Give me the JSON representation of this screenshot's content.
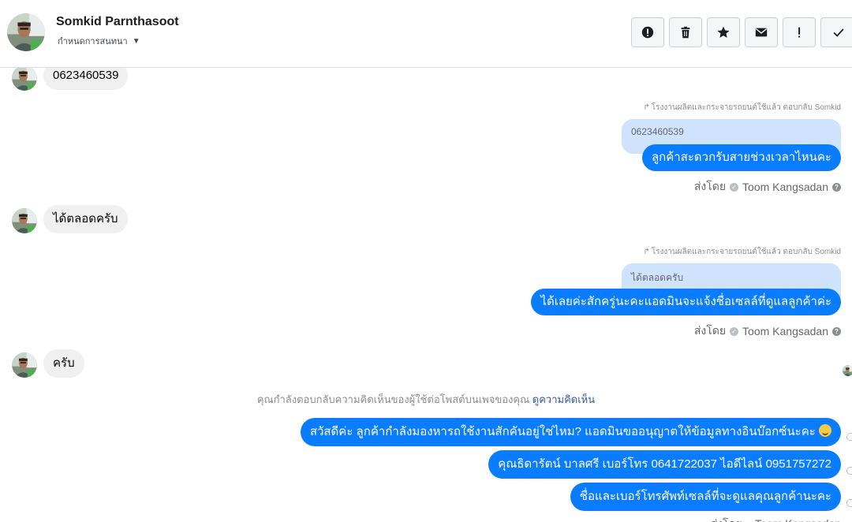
{
  "header": {
    "contact_name": "Somkid Parnthasoot",
    "conversation_label": "กำหนดการสนทนา",
    "actions": [
      {
        "name": "mark-spam",
        "icon": "alert-circle-icon"
      },
      {
        "name": "delete",
        "icon": "trash-icon"
      },
      {
        "name": "star",
        "icon": "star-icon"
      },
      {
        "name": "mark-unread",
        "icon": "envelope-icon"
      },
      {
        "name": "follow-up",
        "icon": "exclamation-icon"
      },
      {
        "name": "mark-done",
        "icon": "check-icon"
      }
    ]
  },
  "thread": {
    "msg1": "0623460539",
    "reply1_note": "โรงงานผลิตและกระจายรถยนต์ใช้แล้ว ตอบกลับ Somkid",
    "reply1_quote": "0623460539",
    "reply1_text": "ลูกค้าสะดวกรับสายช่วงเวลาไหนคะ",
    "sent_by_label": "ส่งโดย",
    "agent_name": "Toom Kangsadan",
    "msg2": "ได้ตลอดครับ",
    "reply2_note": "โรงงานผลิตและกระจายรถยนต์ใช้แล้ว ตอบกลับ Somkid",
    "reply2_quote": "ได้ตลอดครับ",
    "reply2_text": "ได้เลยค่ะสักครู่นะคะแอดมินจะแจ้งชื่อเซลล์ที่ดูแลลูกค้าค่ะ",
    "msg3": "ครับ",
    "system_note": "คุณกำลังตอบกลับความคิดเห็นของผู้ใช้ต่อโพสต์บนเพจของคุณ",
    "system_link": "ดูความคิดเห็น",
    "out1": "สวัสดีค่ะ ลูกค้ากำลังมองหารถใช้งานสักคันอยู่ใช่ไหม? แอดมินขออนุญาตให้ข้อมูลทางอินบ๊อกซ์นะคะ",
    "out2": "คุณธิดารัตน์ บาลศรี เบอร์โทร 0641722037  ไอดีไลน์ 0951757272",
    "out3": "ชื่อและเบอร์โทรศัพท์เซลล์ที่จะดูแลคุณลูกค้านะคะ",
    "sent_by_partial": "ส่งโดย ● Toom Kangsadan"
  },
  "colors": {
    "outgoing": "#0a7cff",
    "incoming": "#f0f0f0",
    "quote": "#cfe3ff",
    "link": "#385898"
  }
}
